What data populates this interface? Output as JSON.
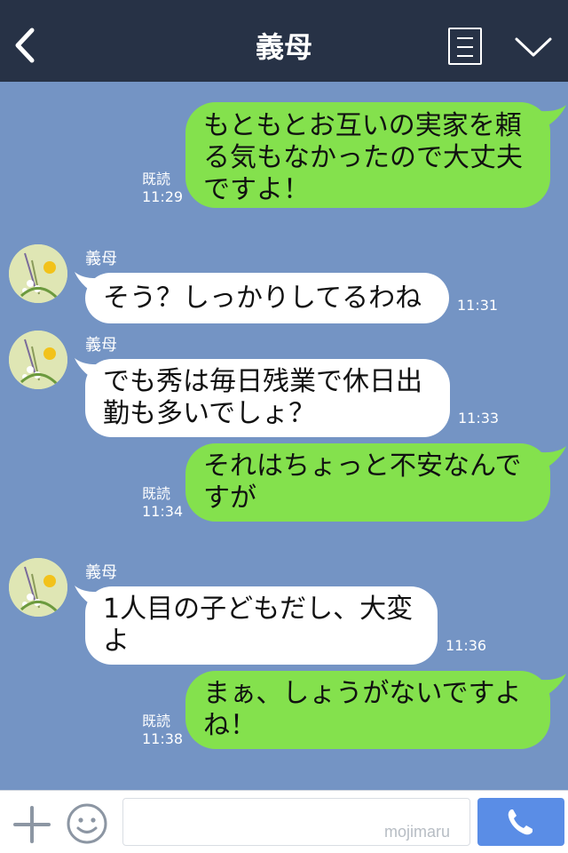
{
  "header": {
    "title": "義母",
    "back_icon": "chevron-left-icon",
    "menu_icon": "list-icon",
    "collapse_icon": "chevron-down-icon"
  },
  "messages": [
    {
      "side": "right",
      "lines": [
        "もともとお互いの実家を頼",
        "る気もなかったので大丈夫",
        "ですよ！"
      ],
      "read": "既読",
      "time": "11:29"
    },
    {
      "side": "left",
      "sender": "義母",
      "lines": [
        "そう？しっかりしてるわね"
      ],
      "time": "11:31"
    },
    {
      "side": "left",
      "sender": "義母",
      "lines": [
        "でも秀は毎日残業で休日出",
        "勤も多いでしょ？"
      ],
      "time": "11:33"
    },
    {
      "side": "right",
      "lines": [
        "それはちょっと不安なんで",
        "すが"
      ],
      "read": "既読",
      "time": "11:34"
    },
    {
      "side": "left",
      "sender": "義母",
      "lines": [
        "1人目の子どもだし、大変",
        "よ"
      ],
      "time": "11:36"
    },
    {
      "side": "right",
      "lines": [
        "まぁ、しょうがないですよ",
        "ね！"
      ],
      "read": "既読",
      "time": "11:38"
    }
  ],
  "footer": {
    "input_value": "",
    "watermark": "mojimaru",
    "plus_icon": "plus-icon",
    "emoji_icon": "smiley-icon",
    "call_icon": "phone-icon"
  },
  "colors": {
    "header_bg": "#273246",
    "chat_bg": "#7494c4",
    "outgoing_bubble": "#84e14d",
    "incoming_bubble": "#ffffff",
    "call_button": "#5a8de6"
  }
}
